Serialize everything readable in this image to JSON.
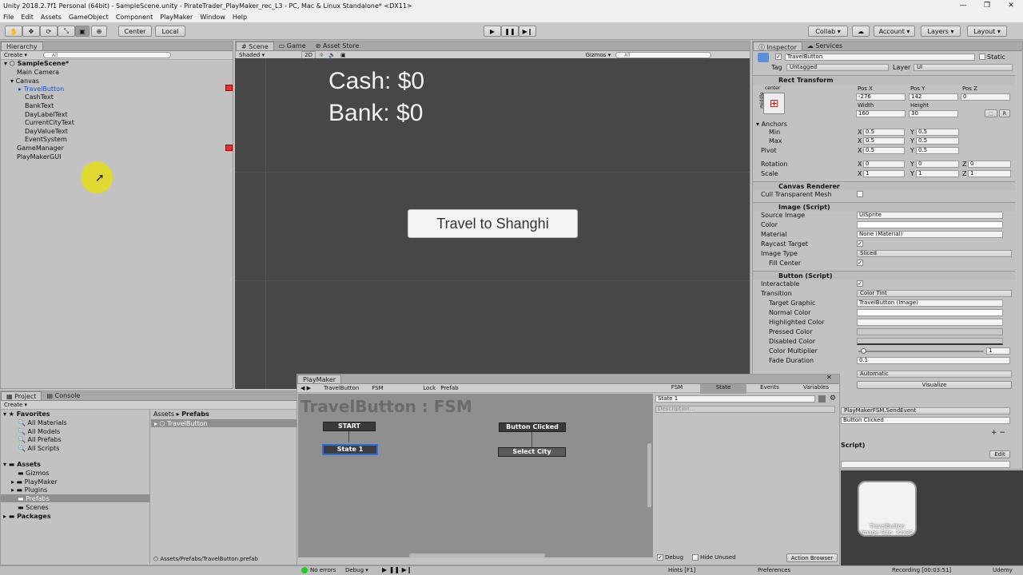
{
  "window": {
    "title": "Unity 2018.2.7f1 Personal (64bit) - SampleScene.unity - PirateTrader_PlayMaker_rec_L3 - PC, Mac & Linux Standalone* <DX11>",
    "minimize": "—",
    "maximize": "❐",
    "close": "✕"
  },
  "menu": [
    "File",
    "Edit",
    "Assets",
    "GameObject",
    "Component",
    "PlayMaker",
    "Window",
    "Help"
  ],
  "toolbar": {
    "center": "Center",
    "local": "Local",
    "collab": "Collab ▾",
    "account": "Account ▾",
    "layers": "Layers ▾",
    "layout": "Layout ▾"
  },
  "hierarchy": {
    "tab": "Hierarchy",
    "create": "Create ▾",
    "search_placeholder": "All",
    "items": [
      "SampleScene*",
      "Main Camera",
      "Canvas",
      "TravelButton",
      "CashText",
      "BankText",
      "DayLabelText",
      "CurrentCityText",
      "DayValueText",
      "EventSystem",
      "GameManager",
      "PlayMakerGUI"
    ]
  },
  "scene": {
    "tabs": [
      "Scene",
      "Game",
      "Asset Store"
    ],
    "shaded": "Shaded ▾",
    "mode2d": "2D",
    "gizmos": "Gizmos ▾",
    "search_placeholder": "All",
    "cash": "Cash: $0",
    "bank": "Bank: $0",
    "button_text": "Travel to Shanghi"
  },
  "inspector": {
    "tabs": [
      "Inspector",
      "Services"
    ],
    "object_name": "TravelButton",
    "static": "Static",
    "tag_label": "Tag",
    "tag_value": "Untagged",
    "layer_label": "Layer",
    "layer_value": "UI",
    "rect": {
      "title": "Rect Transform",
      "anchor_h": "center",
      "anchor_v": "middle",
      "posx_label": "Pos X",
      "posy_label": "Pos Y",
      "posz_label": "Pos Z",
      "posx": "-276",
      "posy": "142",
      "posz": "0",
      "width_label": "Width",
      "height_label": "Height",
      "width": "160",
      "height": "30",
      "r_button": "R",
      "anchors": "Anchors",
      "min": "Min",
      "max": "Max",
      "pivot": "Pivot",
      "rotation": "Rotation",
      "scale": "Scale",
      "x": "X",
      "y": "Y",
      "z": "Z",
      "min_x": "0.5",
      "min_y": "0.5",
      "max_x": "0.5",
      "max_y": "0.5",
      "pivot_x": "0.5",
      "pivot_y": "0.5",
      "rot_x": "0",
      "rot_y": "0",
      "rot_z": "0",
      "scale_x": "1",
      "scale_y": "1",
      "scale_z": "1"
    },
    "canvas_renderer": {
      "title": "Canvas Renderer",
      "cull": "Cull Transparent Mesh"
    },
    "image": {
      "title": "Image (Script)",
      "source_label": "Source Image",
      "source": "UISprite",
      "color_label": "Color",
      "material_label": "Material",
      "material": "None (Material)",
      "raycast_label": "Raycast Target",
      "type_label": "Image Type",
      "type": "Sliced",
      "fill_label": "Fill Center"
    },
    "button": {
      "title": "Button (Script)",
      "interactable_label": "Interactable",
      "transition_label": "Transition",
      "transition": "Color Tint",
      "target_label": "Target Graphic",
      "target": "TravelButton (Image)",
      "normal_label": "Normal Color",
      "highlighted_label": "Highlighted Color",
      "pressed_label": "Pressed Color",
      "disabled_label": "Disabled Color",
      "multiplier_label": "Color Multiplier",
      "multiplier": "1",
      "fade_label": "Fade Duration",
      "fade": "0.1",
      "multiplier_fraction": 0.04
    },
    "navigation": {
      "value": "Automatic",
      "visualize": "Visualize"
    },
    "onclick": {
      "func": "PlayMakerFSM.SendEvent",
      "arg": "Button Clicked",
      "script_label": "Script)",
      "edit": "Edit"
    },
    "preview_caption": "TravelButton\nImage Size: 32x32"
  },
  "project": {
    "tabs": [
      "Project",
      "Console"
    ],
    "create": "Create ▾",
    "favorites": [
      "Favorites",
      "All Materials",
      "All Models",
      "All Prefabs",
      "All Scripts"
    ],
    "assets": [
      "Assets",
      "Gizmos",
      "PlayMaker",
      "Plugins",
      "Prefabs",
      "Scenes"
    ],
    "packages": "Packages",
    "breadcrumb_root": "Assets",
    "breadcrumb_sep": "▸",
    "breadcrumb_current": "Prefabs",
    "item": "TravelButton",
    "path": "Assets/Prefabs/TravelButton.prefab"
  },
  "playmaker": {
    "tab": "PlayMaker",
    "toolbar": {
      "object": "TravelButton",
      "fsm": "FSM",
      "lock": "Lock",
      "prefab": "Prefab"
    },
    "fsm_title": "TravelButton : FSM",
    "states": {
      "start": "START",
      "state1": "State 1",
      "event": "Button Clicked",
      "select_city": "Select City"
    },
    "side_tabs": [
      "FSM",
      "State",
      "Events",
      "Variables"
    ],
    "state_name": "State 1",
    "description": "Description...",
    "debug": "Debug",
    "hide_unused": "Hide Unused",
    "action_browser": "Action Browser",
    "hints": "Hints [F1]",
    "preferences": "Preferences",
    "no_errors": "No errors",
    "debug_dropdown": "Debug ▾"
  },
  "status": {
    "recording": "Recording [00:03:51]",
    "udemy": "Udemy"
  },
  "colors": {
    "selection_blue": "#1a4fd6",
    "scene_bg": "#474747",
    "fsm_bg": "#8f8f8f",
    "cursor_highlight": "#e8e000"
  }
}
